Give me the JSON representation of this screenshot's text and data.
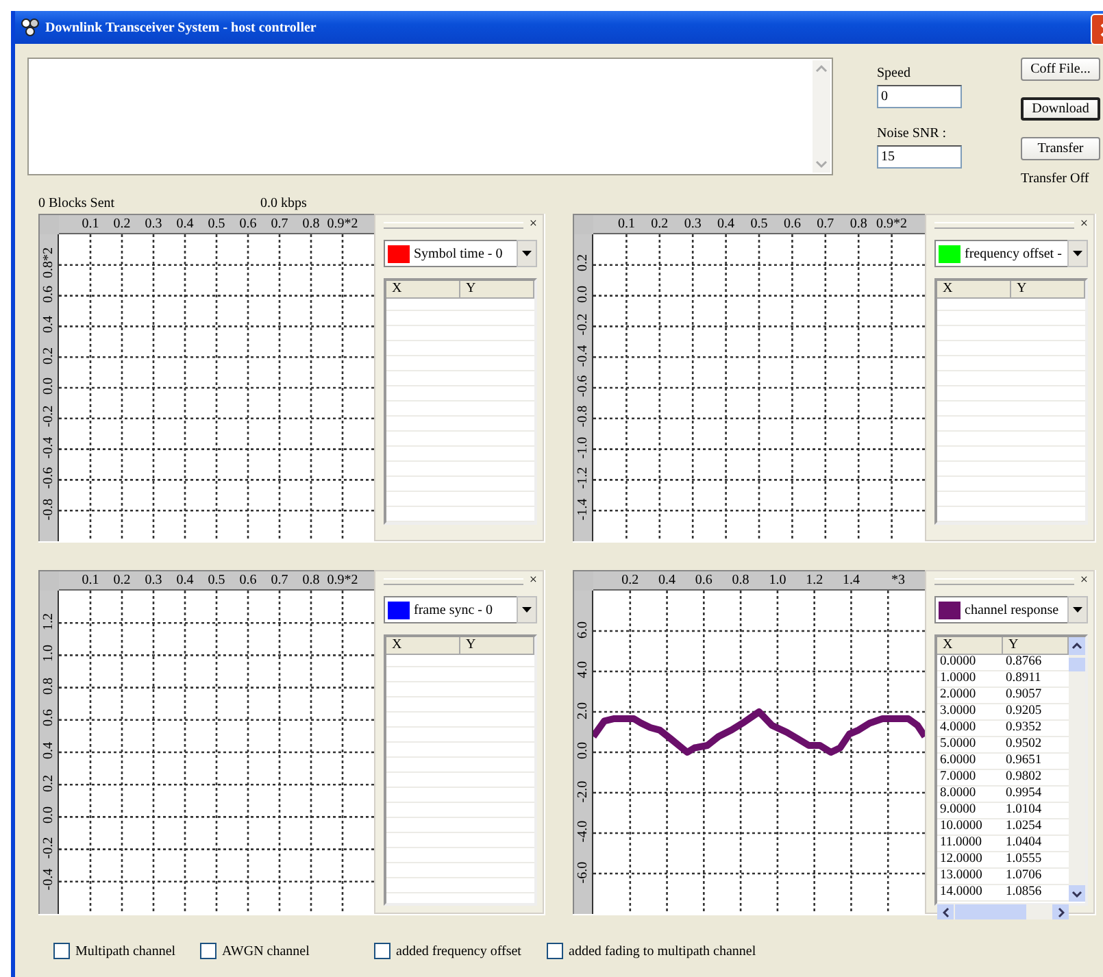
{
  "window": {
    "title": "Downlink Transceiver System - host controller"
  },
  "fields": [
    {
      "label": "Speed",
      "value": "0"
    },
    {
      "label": "Noise SNR :",
      "value": "15"
    }
  ],
  "buttons": [
    {
      "label": "Coff File...",
      "default": false
    },
    {
      "label": "Download",
      "default": true
    },
    {
      "label": "Transfer",
      "default": false
    }
  ],
  "transfer_status": "Transfer Off",
  "status": {
    "blocks_sent": "0 Blocks Sent",
    "rate": "0.0 kbps"
  },
  "plots": [
    {
      "x_ticks": [
        "0.1",
        "0.2",
        "0.3",
        "0.4",
        "0.5",
        "0.6",
        "0.7",
        "0.8",
        "0.9*2"
      ],
      "y_ticks": [
        "0.8*2",
        "0.6",
        "0.4",
        "0.2",
        "0.0",
        "-0.2",
        "-0.4",
        "-0.6",
        "-0.8"
      ],
      "close": "×",
      "legend": {
        "label": "Symbol time - 0",
        "color": "#ff0000"
      },
      "columns": [
        "X",
        "Y"
      ]
    },
    {
      "x_ticks": [
        "0.1",
        "0.2",
        "0.3",
        "0.4",
        "0.5",
        "0.6",
        "0.7",
        "0.8",
        "0.9*2"
      ],
      "y_ticks": [
        "0.2",
        "0.0",
        "-0.2",
        "-0.4",
        "-0.6",
        "-0.8",
        "-1.0",
        "-1.2",
        "-1.4"
      ],
      "close": "×",
      "legend": {
        "label": "frequency offset -",
        "color": "#00ff00"
      },
      "columns": [
        "X",
        "Y"
      ]
    },
    {
      "x_ticks": [
        "0.1",
        "0.2",
        "0.3",
        "0.4",
        "0.5",
        "0.6",
        "0.7",
        "0.8",
        "0.9*2"
      ],
      "y_ticks": [
        "1.2",
        "1.0",
        "0.8",
        "0.6",
        "0.4",
        "0.2",
        "0.0",
        "-0.2",
        "-0.4"
      ],
      "close": "×",
      "legend": {
        "label": "frame sync - 0",
        "color": "#0000ff"
      },
      "columns": [
        "X",
        "Y"
      ]
    },
    {
      "chart_data": {
        "type": "line",
        "xlim": [
          0,
          1.8
        ],
        "ylim": [
          -8,
          8
        ],
        "xticks": [
          {
            "value": 0.2,
            "label": "0.2"
          },
          {
            "value": 0.4,
            "label": "0.4"
          },
          {
            "value": 0.6,
            "label": "0.6"
          },
          {
            "value": 0.8,
            "label": "0.8"
          },
          {
            "value": 1.0,
            "label": "1.0"
          },
          {
            "value": 1.2,
            "label": "1.2"
          },
          {
            "value": 1.4,
            "label": "1.4"
          }
        ],
        "grid": true,
        "yticks": [
          {
            "value": 6,
            "label": "6.0"
          },
          {
            "value": 4,
            "label": "4.0"
          },
          {
            "value": 2,
            "label": "2.0"
          },
          {
            "value": 0,
            "label": "0.0"
          },
          {
            "value": -2,
            "label": "-2.0"
          },
          {
            "value": -4,
            "label": "-4.0"
          },
          {
            "value": -6,
            "label": "-6.0"
          }
        ],
        "x": [
          0,
          0.06,
          0.11,
          0.22,
          0.26,
          0.31,
          0.36,
          0.42,
          0.51,
          0.55,
          0.62,
          0.68,
          0.75,
          0.81,
          0.9,
          0.97,
          1.05,
          1.11,
          1.17,
          1.23,
          1.29,
          1.34,
          1.39,
          1.44,
          1.5,
          1.57,
          1.71,
          1.76,
          1.8
        ],
        "series": [
          {
            "color": "#6a0f6a",
            "values": [
              0.78,
              1.55,
              1.66,
              1.66,
              1.44,
              1.22,
              1.1,
              0.67,
              0,
              0.22,
              0.34,
              0.78,
              1.1,
              1.44,
              2.0,
              1.33,
              0.99,
              0.67,
              0.34,
              0.34,
              0,
              0.22,
              0.9,
              1.1,
              1.44,
              1.66,
              1.66,
              1.33,
              0.78
            ]
          }
        ]
      },
      "x_multiplier": "*3",
      "close": "×",
      "legend": {
        "label": "channel response",
        "color": "#6a0f6a"
      },
      "columns": [
        "X",
        "Y"
      ],
      "rows": [
        [
          "0.0000",
          "0.8766"
        ],
        [
          "1.0000",
          "0.8911"
        ],
        [
          "2.0000",
          "0.9057"
        ],
        [
          "3.0000",
          "0.9205"
        ],
        [
          "4.0000",
          "0.9352"
        ],
        [
          "5.0000",
          "0.9502"
        ],
        [
          "6.0000",
          "0.9651"
        ],
        [
          "7.0000",
          "0.9802"
        ],
        [
          "8.0000",
          "0.9954"
        ],
        [
          "9.0000",
          "1.0104"
        ],
        [
          "10.0000",
          "1.0254"
        ],
        [
          "11.0000",
          "1.0404"
        ],
        [
          "12.0000",
          "1.0555"
        ],
        [
          "13.0000",
          "1.0706"
        ],
        [
          "14.0000",
          "1.0856"
        ]
      ]
    }
  ],
  "checkboxes": [
    {
      "label": "Multipath channel",
      "checked": false
    },
    {
      "label": "AWGN channel",
      "checked": false
    },
    {
      "label": "added frequency offset",
      "checked": false
    },
    {
      "label": "added fading to multipath channel",
      "checked": false
    }
  ]
}
